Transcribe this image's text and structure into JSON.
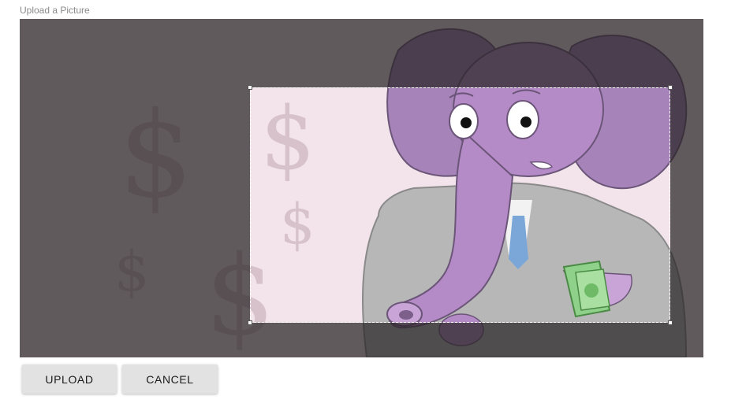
{
  "form": {
    "label": "Upload a Picture"
  },
  "image": {
    "icon": "elephant-holding-money-illustration",
    "dollar_sign": "$"
  },
  "buttons": {
    "upload_label": "UPLOAD",
    "cancel_label": "CANCEL"
  },
  "colors": {
    "overlay": "#5f5a5c",
    "picture_background": "#f2e4ea",
    "elephant": "#b58bc7",
    "button_background": "#e2e2e2"
  }
}
